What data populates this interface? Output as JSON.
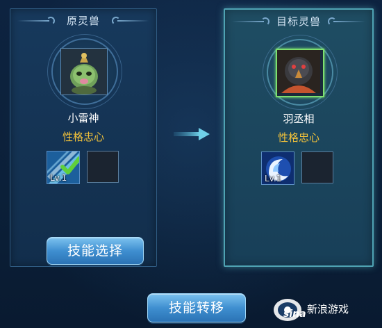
{
  "source_panel": {
    "title": "原灵兽",
    "pet_name": "小雷神",
    "trait": "性格忠心",
    "skill": {
      "level": "Lv.1",
      "icon": "wind-slash-skill-icon",
      "selected": true
    }
  },
  "target_panel": {
    "title": "目标灵兽",
    "pet_name": "羽丞相",
    "trait": "性格忠心",
    "skill": {
      "level": "Lv.1",
      "icon": "water-vortex-skill-icon",
      "selected": false
    }
  },
  "buttons": {
    "select_skill": "技能选择",
    "transfer_skill": "技能转移"
  },
  "watermark": {
    "brand": "sina",
    "text": "新浪游戏"
  },
  "colors": {
    "trait": "#f2c23a",
    "target_border": "#4fa3b3",
    "button": "#3f8fd0",
    "selected_frame": "#7de06e"
  }
}
